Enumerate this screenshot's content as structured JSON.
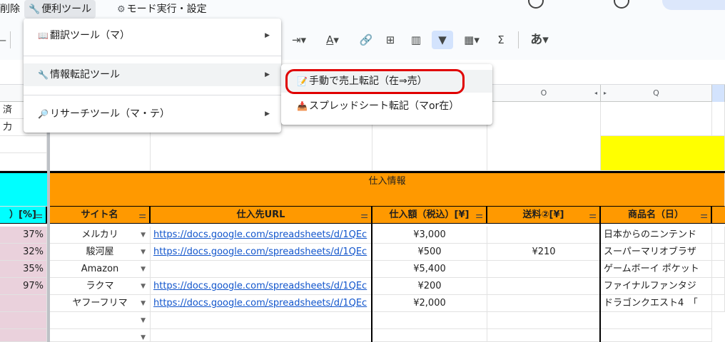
{
  "menubar": {
    "delete_label": "削除",
    "tools_label": "便利ツール",
    "mode_label": "モード実行・設定"
  },
  "toolbar": {
    "text_color_glyph": "A",
    "sigma_glyph": "Σ",
    "ime_label": "あ"
  },
  "columns": {
    "o": "O",
    "q": "Q"
  },
  "tools_menu": {
    "items": [
      {
        "icon": "book-icon",
        "label": "翻訳ツール（マ）"
      },
      {
        "icon": "wrench-icon",
        "label": "情報転記ツール"
      },
      {
        "icon": "magnifier-icon",
        "label": "リサーチツール（マ・テ）"
      }
    ]
  },
  "transfer_submenu": {
    "items": [
      {
        "icon": "edit-icon",
        "label": "手動で売上転記（在⇒売）"
      },
      {
        "icon": "download-icon",
        "label": "スプレッドシート転記（マor在）"
      }
    ]
  },
  "left_cells": {
    "r1": "済",
    "r2": "力"
  },
  "sheet": {
    "section_header": "仕入情報",
    "headers": {
      "pct": "）[%]",
      "site": "サイト名",
      "url": "仕入先URL",
      "price": "仕入額（税込）[¥]",
      "shipping": "送料②[¥]",
      "product": "商品名（日）"
    },
    "rows": [
      {
        "pct": "37%",
        "site": "メルカリ",
        "url": "https://docs.google.com/spreadsheets/d/1QEc",
        "price": "¥3,000",
        "shipping": "",
        "product": "日本からのニンテンド"
      },
      {
        "pct": "32%",
        "site": "駿河屋",
        "url": "https://docs.google.com/spreadsheets/d/1QEc",
        "price": "¥500",
        "shipping": "¥210",
        "product": "スーパーマリオブラザ"
      },
      {
        "pct": "35%",
        "site": "Amazon",
        "url": "",
        "price": "¥5,400",
        "shipping": "",
        "product": "ゲームボーイ ポケット"
      },
      {
        "pct": "97%",
        "site": "ラクマ",
        "url": "https://docs.google.com/spreadsheets/d/1QEc",
        "price": "¥200",
        "shipping": "",
        "product": "ファイナルファンタジ"
      },
      {
        "pct": "",
        "site": "ヤフーフリマ",
        "url": "https://docs.google.com/spreadsheets/d/1QEc",
        "price": "¥2,000",
        "shipping": "",
        "product": "ドラゴンクエスト4　「"
      }
    ]
  }
}
